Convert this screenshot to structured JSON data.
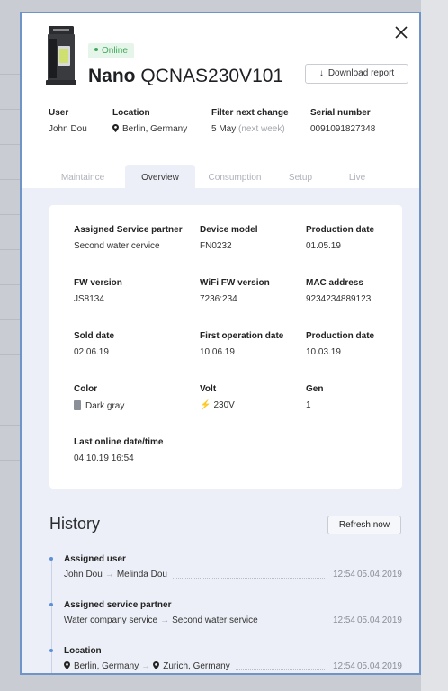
{
  "device": {
    "status": "Online",
    "name_bold": "Nano",
    "name_model": "QCNAS230V101",
    "download_label": "Download report"
  },
  "info": [
    {
      "label": "User",
      "value": "John Dou"
    },
    {
      "label": "Location",
      "value": "Berlin, Germany"
    },
    {
      "label": "Filter next change",
      "value": "5 May",
      "note": "(next week)"
    },
    {
      "label": "Serial number",
      "value": "0091091827348"
    }
  ],
  "tabs": [
    {
      "label": "Maintaince"
    },
    {
      "label": "Overview"
    },
    {
      "label": "Consumption"
    },
    {
      "label": "Setup"
    },
    {
      "label": "Live"
    }
  ],
  "active_tab": "Overview",
  "details": [
    {
      "label": "Assigned Service partner",
      "value": "Second water cervice"
    },
    {
      "label": "Device model",
      "value": "FN0232"
    },
    {
      "label": "Production date",
      "value": "01.05.19"
    },
    {
      "label": "FW version",
      "value": "JS8134"
    },
    {
      "label": "WiFi FW version",
      "value": "7236:234"
    },
    {
      "label": "MAC address",
      "value": "9234234889123"
    },
    {
      "label": "Sold date",
      "value": "02.06.19"
    },
    {
      "label": "First operation date",
      "value": "10.06.19"
    },
    {
      "label": "Production date",
      "value": "10.03.19"
    },
    {
      "label": "Color",
      "value": "Dark gray"
    },
    {
      "label": "Volt",
      "value": "230V"
    },
    {
      "label": "Gen",
      "value": "1"
    },
    {
      "label": "Last online date/time",
      "value": "04.10.19 16:54"
    }
  ],
  "history": {
    "title": "History",
    "refresh_label": "Refresh now",
    "items": [
      {
        "title": "Assigned user",
        "from": "John Dou",
        "to": "Melinda Dou",
        "time": "12:54",
        "date": "05.04.2019"
      },
      {
        "title": "Assigned service partner",
        "from": "Water company service",
        "to": "Second water service",
        "time": "12:54",
        "date": "05.04.2019"
      },
      {
        "title": "Location",
        "from": "Berlin, Germany",
        "to": "Zurich, Germany",
        "time": "12:54",
        "date": "05.04.2019"
      }
    ]
  },
  "colors": {
    "accent_border": "#6f94c8",
    "online_green": "#3fa85a",
    "panel_body": "#eceff7",
    "color_swatch": "#8a8f98",
    "volt_bolt": "#e3b02c",
    "timeline_dot": "#5b8fd6"
  },
  "icons": {
    "close": "close-icon",
    "download": "download-arrow-icon",
    "location": "location-pin-icon",
    "volt": "lightning-bolt-icon",
    "arrow": "arrow-right-icon"
  }
}
